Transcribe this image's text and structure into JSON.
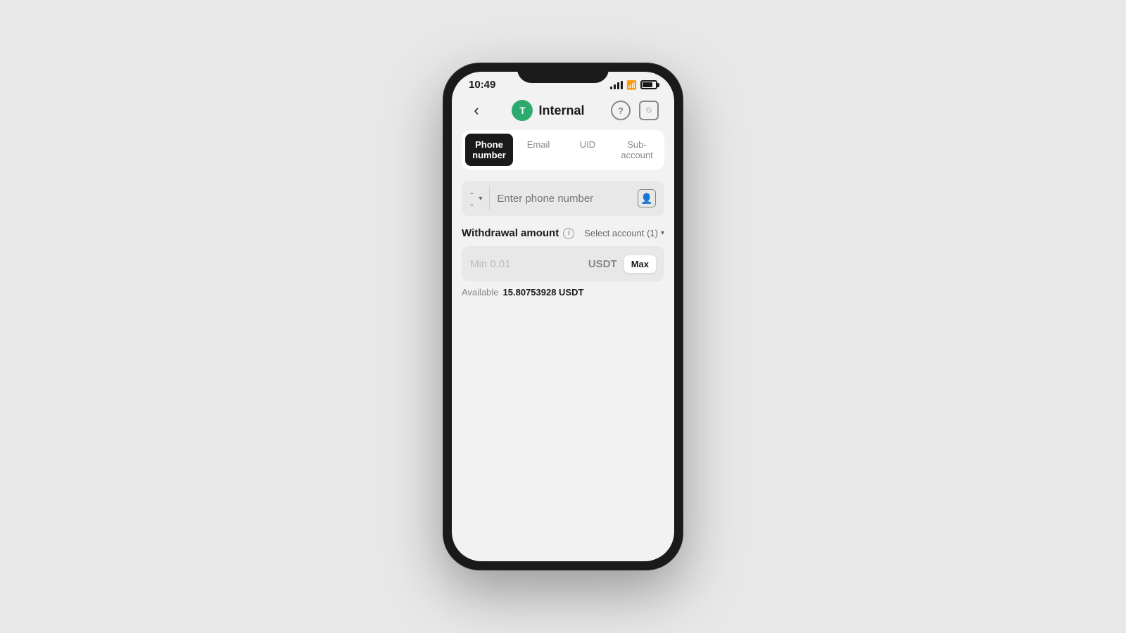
{
  "status_bar": {
    "time": "10:49"
  },
  "header": {
    "logo_letter": "T",
    "title": "Internal",
    "help_label": "?",
    "history_label": "⊙"
  },
  "tabs": [
    {
      "id": "phone",
      "label": "Phone number",
      "active": true
    },
    {
      "id": "email",
      "label": "Email",
      "active": false
    },
    {
      "id": "uid",
      "label": "UID",
      "active": false
    },
    {
      "id": "subaccount",
      "label": "Sub-account",
      "active": false
    }
  ],
  "phone_input": {
    "country_code": "--",
    "placeholder": "Enter phone number"
  },
  "withdrawal": {
    "label": "Withdrawal amount",
    "select_account": "Select account (1)",
    "amount_placeholder": "Min 0.01",
    "currency": "USDT",
    "max_btn": "Max",
    "available_label": "Available",
    "available_amount": "15.80753928 USDT"
  }
}
